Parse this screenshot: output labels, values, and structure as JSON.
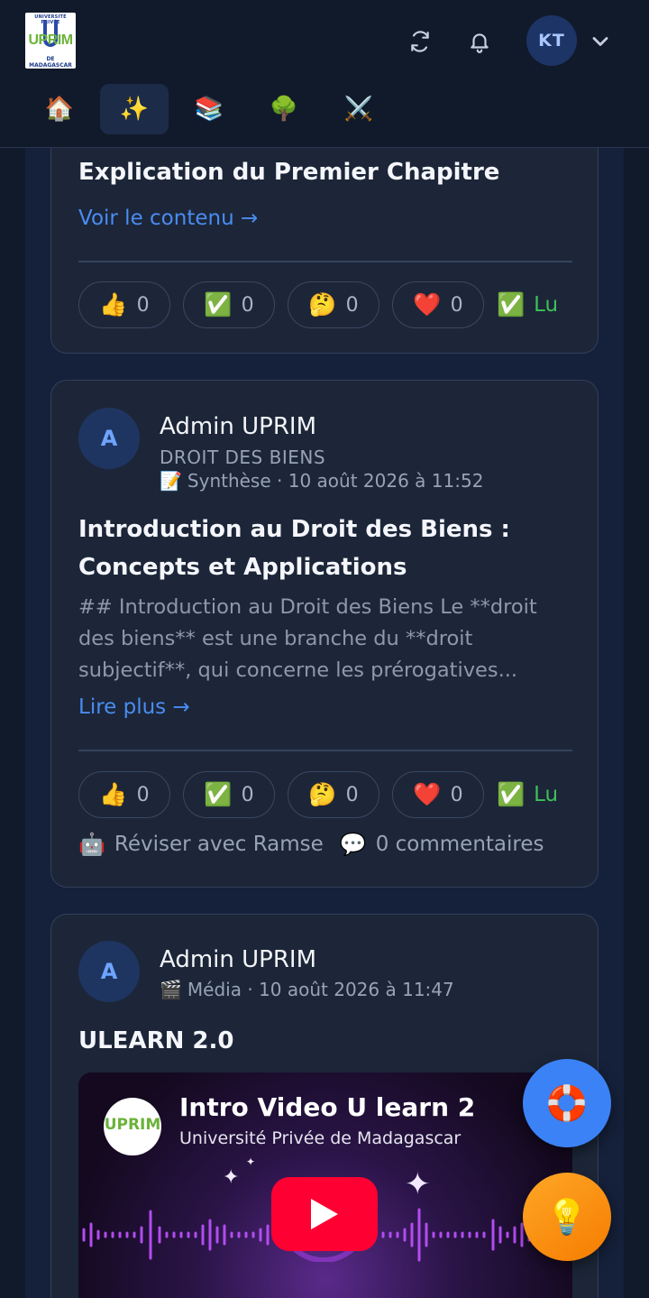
{
  "header": {
    "logo": {
      "name": "UPRIM",
      "arc_text": "UNIVERSITÉ PRIVÉE",
      "sub_text": "DE MADAGASCAR"
    },
    "sync_icon": "refresh-icon",
    "bell_icon": "bell-icon",
    "user_initials": "KT",
    "nav_tabs": [
      {
        "icon": "🏠",
        "name": "home"
      },
      {
        "icon": "✨",
        "name": "sparkles",
        "active": true
      },
      {
        "icon": "📚",
        "name": "books"
      },
      {
        "icon": "🌳",
        "name": "tree"
      },
      {
        "icon": "⚔️",
        "name": "swords"
      }
    ]
  },
  "posts": [
    {
      "title": "Explication du Premier Chapitre",
      "link_label": "Voir le contenu →",
      "reactions": [
        {
          "emoji": "👍",
          "count": "0"
        },
        {
          "emoji": "✅",
          "count": "0"
        },
        {
          "emoji": "🤔",
          "count": "0"
        },
        {
          "emoji": "❤️",
          "count": "0"
        }
      ],
      "read_emoji": "✅",
      "read_label": "Lu"
    },
    {
      "author_initial": "A",
      "author": "Admin UPRIM",
      "course": "DROIT DES BIENS",
      "meta_emoji": "📝",
      "meta": "Synthèse · 10 août 2026 à 11:52",
      "title_line1": "Introduction au Droit des Biens :",
      "title_line2": "Concepts et Applications",
      "excerpt": "## Introduction au Droit des Biens Le **droit des biens** est une branche du **droit subjectif**, qui concerne les prérogatives...",
      "link_label": "Lire plus →",
      "reactions": [
        {
          "emoji": "👍",
          "count": "0"
        },
        {
          "emoji": "✅",
          "count": "0"
        },
        {
          "emoji": "🤔",
          "count": "0"
        },
        {
          "emoji": "❤️",
          "count": "0"
        }
      ],
      "read_emoji": "✅",
      "read_label": "Lu",
      "revise_emoji": "🤖",
      "revise_label": "Réviser avec Ramse",
      "comments_emoji": "💬",
      "comments_label": "0 commentaires"
    },
    {
      "author_initial": "A",
      "author": "Admin UPRIM",
      "meta_emoji": "🎬",
      "meta": "Média · 10 août 2026 à 11:47",
      "title": "ULEARN 2.0",
      "video": {
        "title": "Intro Video U learn 2",
        "channel": "Université Privée de Madagascar",
        "logo_text": "UPRIM",
        "play_icon": "youtube-play-icon"
      }
    }
  ],
  "fabs": {
    "help_icon": "🛟",
    "idea_icon": "💡"
  }
}
